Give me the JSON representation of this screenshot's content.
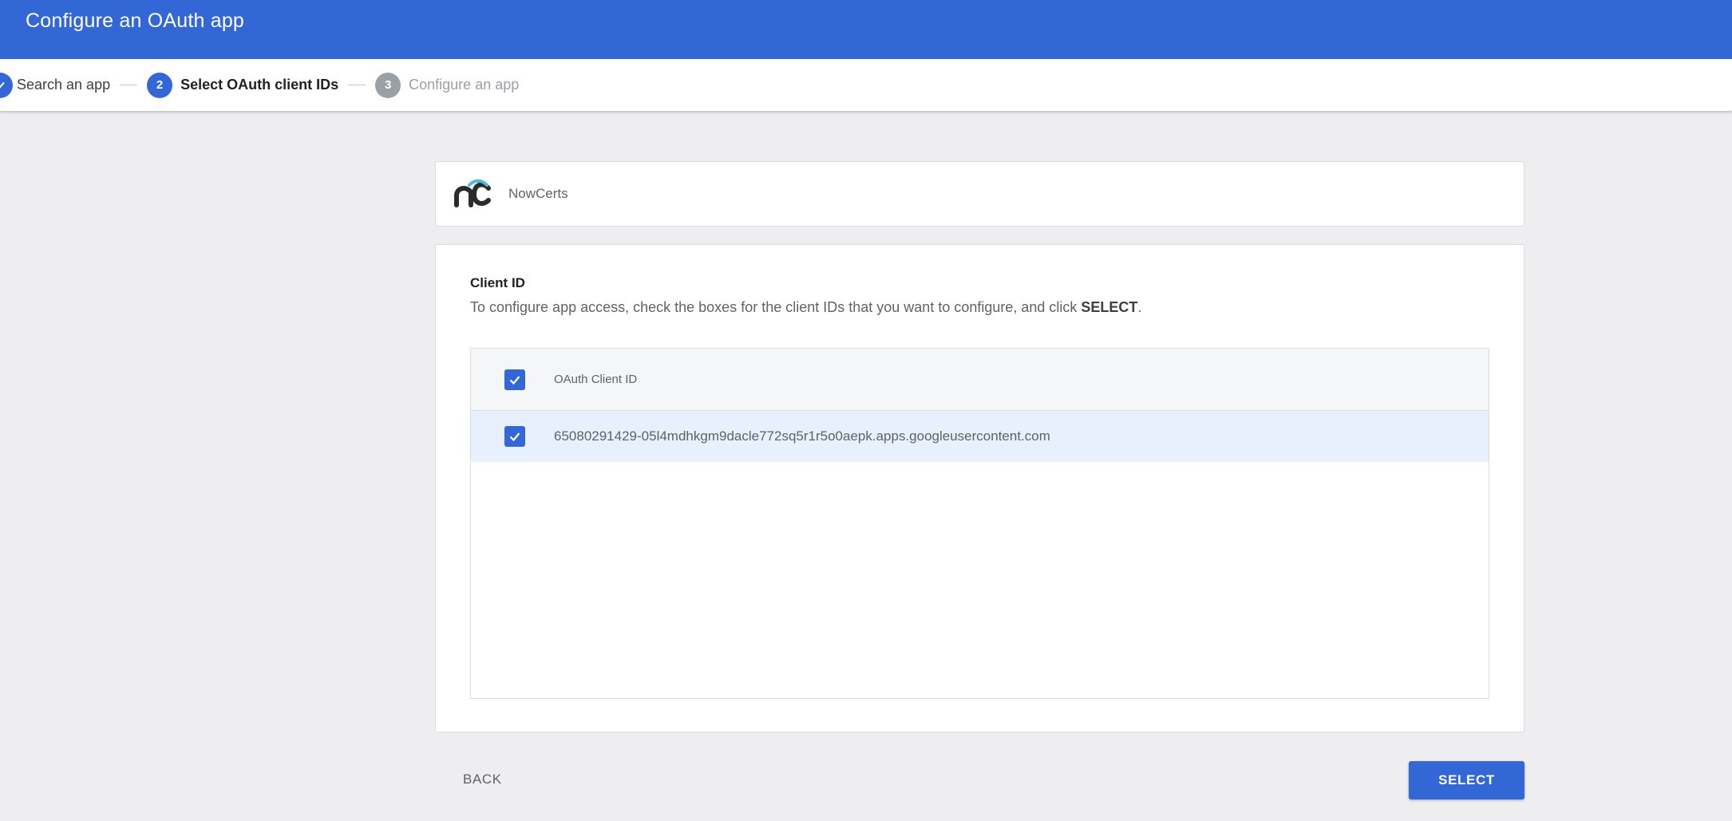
{
  "header": {
    "title": "Configure an OAuth app"
  },
  "stepper": {
    "steps": [
      {
        "number": "1",
        "label": "Search an app",
        "state": "done"
      },
      {
        "number": "2",
        "label": "Select OAuth client IDs",
        "state": "active"
      },
      {
        "number": "3",
        "label": "Configure an app",
        "state": "pending"
      }
    ]
  },
  "app": {
    "name": "NowCerts",
    "logo_icon": "nowcerts-logo-icon"
  },
  "client_section": {
    "title": "Client ID",
    "description_prefix": "To configure app access, check the boxes for the client IDs that you want to configure, and click ",
    "description_emphasis": "SELECT",
    "description_suffix": ".",
    "table": {
      "header_label": "OAuth Client ID",
      "header_checked": true,
      "rows": [
        {
          "client_id": "65080291429-05l4mdhkgm9dacle772sq5r1r5o0aepk.apps.googleusercontent.com",
          "checked": true
        }
      ]
    }
  },
  "actions": {
    "back_label": "BACK",
    "select_label": "SELECT"
  },
  "colors": {
    "accent": "#3367d6",
    "selected_row": "#e8f0fe"
  }
}
